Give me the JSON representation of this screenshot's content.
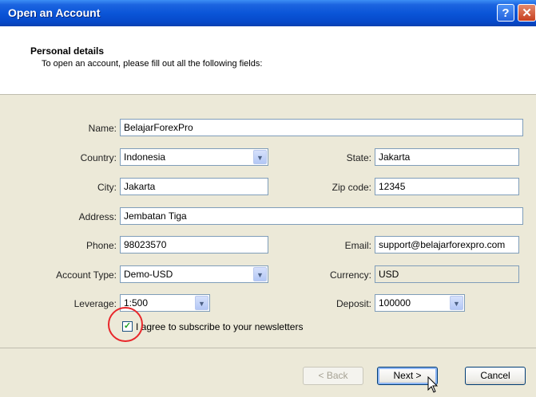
{
  "window": {
    "title": "Open an Account",
    "help_glyph": "?",
    "close_glyph": "✕"
  },
  "header": {
    "title": "Personal details",
    "subtitle": "To open an account, please fill out all the following fields:"
  },
  "form": {
    "name": {
      "label": "Name:",
      "value": "BelajarForexPro"
    },
    "country": {
      "label": "Country:",
      "value": "Indonesia"
    },
    "state": {
      "label": "State:",
      "value": "Jakarta"
    },
    "city": {
      "label": "City:",
      "value": "Jakarta"
    },
    "zip": {
      "label": "Zip code:",
      "value": "12345"
    },
    "address": {
      "label": "Address:",
      "value": "Jembatan Tiga"
    },
    "phone": {
      "label": "Phone:",
      "value": "98023570"
    },
    "email": {
      "label": "Email:",
      "value": "support@belajarforexpro.com"
    },
    "account_type": {
      "label": "Account Type:",
      "value": "Demo-USD"
    },
    "currency": {
      "label": "Currency:",
      "value": "USD"
    },
    "leverage": {
      "label": "Leverage:",
      "value": "1:500"
    },
    "deposit": {
      "label": "Deposit:",
      "value": "100000"
    },
    "newsletter": {
      "label": "I agree to subscribe to your newsletters",
      "checked": true
    }
  },
  "buttons": {
    "back": "< Back",
    "next": "Next >",
    "cancel": "Cancel"
  }
}
